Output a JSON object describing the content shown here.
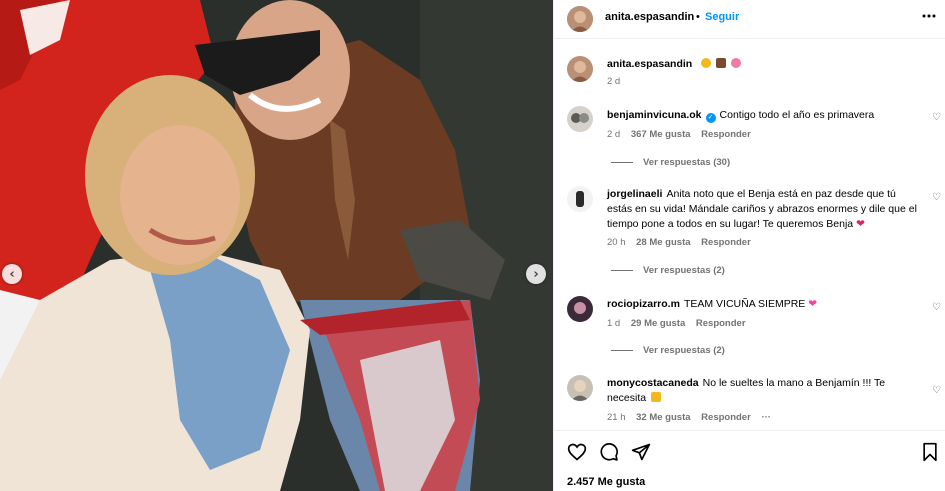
{
  "colors": {
    "link": "#0095f6",
    "muted": "#737373",
    "heart": "#ff3366",
    "photo_red": "#d2241c"
  },
  "header": {
    "username": "anita.espasandin",
    "separator": "•",
    "follow_label": "Seguir",
    "more_icon": "more-horizontal-icon"
  },
  "caption": {
    "username": "anita.espasandin",
    "emojis": [
      "smile-emoji",
      "brown-heart-emoji",
      "pink-flower-emoji"
    ],
    "time": "2 d"
  },
  "comments": [
    {
      "username": "benjaminvicuna.ok",
      "verified": true,
      "text": "Contigo todo el año es primavera",
      "time": "2 d",
      "likes": "367 Me gusta",
      "reply": "Responder",
      "view_replies": "Ver respuestas (30)"
    },
    {
      "username": "jorgelinaeli",
      "verified": false,
      "text": "Anita noto que el Benja está en paz desde que tú estás en su vida! Mándale cariños y abrazos enormes y dile que el tiempo pone a todos en su lugar! Te queremos Benja",
      "time": "20 h",
      "likes": "28 Me gusta",
      "reply": "Responder",
      "view_replies": "Ver respuestas (2)"
    },
    {
      "username": "rociopizarro.m",
      "verified": false,
      "text": "TEAM VICUÑA SIEMPRE",
      "time": "1 d",
      "likes": "29 Me gusta",
      "reply": "Responder",
      "view_replies": "Ver respuestas (2)"
    },
    {
      "username": "monycostacaneda",
      "verified": false,
      "text": "No le sueltes la mano a Benjamín !!! Te necesita",
      "time": "21 h",
      "likes": "32 Me gusta",
      "reply": "Responder",
      "more": "···"
    }
  ],
  "actions": {
    "icons": [
      "heart-icon",
      "comment-icon",
      "share-icon",
      "bookmark-icon"
    ],
    "likes": "2.457 Me gusta"
  },
  "carousel": {
    "prev": "‹",
    "next": "›"
  }
}
